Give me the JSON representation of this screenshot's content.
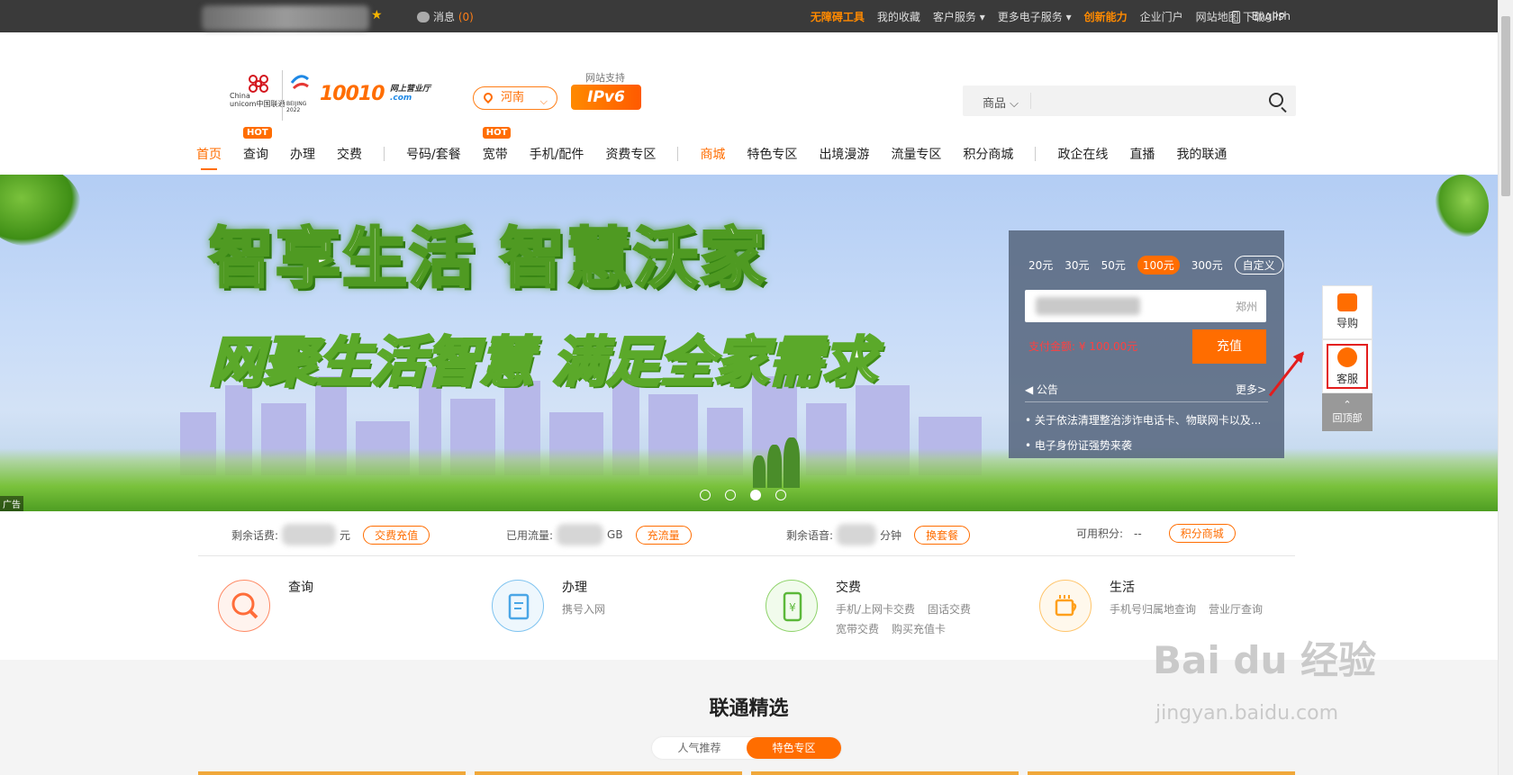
{
  "topbar": {
    "star": "★",
    "message_label": "消息",
    "message_count": "(0)",
    "links": [
      "无障碍工具",
      "我的收藏",
      "客户服务 ▾",
      "更多电子服务 ▾",
      "创新能力",
      "企业门户",
      "网站地图",
      "English"
    ],
    "app_label": "下载APP"
  },
  "header": {
    "logo_brand_line1": "China",
    "logo_brand_line2": "unicom中国联通",
    "logo_olympic": "BEIJING 2022",
    "logo_number": "10010",
    "logo_sub1": "网上营业厅",
    "logo_sub2": ".com",
    "province": "河南",
    "ipv6_caption": "网站支持",
    "ipv6_label": "IPv6",
    "search_category": "商品 ⌵",
    "search_value": ""
  },
  "nav": {
    "items": [
      "首页",
      "查询",
      "办理",
      "交费",
      "号码/套餐",
      "宽带",
      "手机/配件",
      "资费专区",
      "商城",
      "特色专区",
      "出境漫游",
      "流量专区",
      "积分商城",
      "政企在线",
      "直播",
      "我的联通"
    ],
    "hot_badge": "HOT"
  },
  "banner": {
    "headline1": "智享生活 智慧沃家",
    "headline2": "网聚生活智慧 满足全家需求",
    "ad_tag": "广告"
  },
  "recharge": {
    "amounts": [
      "20元",
      "30元",
      "50元",
      "100元",
      "300元"
    ],
    "selected_amount": "100元",
    "custom_label": "自定义",
    "city": "郑州",
    "pay_text": "支付金额: ¥ 100.00元",
    "button": "充值",
    "announce_title": "公告",
    "announce_more": "更多>",
    "notices": [
      "• 关于依法清理整治涉诈电话卡、物联网卡以及...",
      "• 电子身份证强势来袭"
    ]
  },
  "float_bar": {
    "guide": "导购",
    "service": "客服",
    "top": "回顶部"
  },
  "stats": {
    "balance_label": "剩余话费:",
    "balance_unit": "元",
    "balance_btn": "交费充值",
    "flow_label": "已用流量:",
    "flow_unit": "GB",
    "flow_btn": "充流量",
    "voice_label": "剩余语音:",
    "voice_unit": "分钟",
    "voice_btn": "换套餐",
    "points_label": "可用积分:",
    "points_value": "--",
    "points_btn": "积分商城"
  },
  "services": [
    {
      "title": "查询",
      "subs": []
    },
    {
      "title": "办理",
      "subs": [
        "携号入网"
      ]
    },
    {
      "title": "交费",
      "subs": [
        "手机/上网卡交费",
        "固话交费",
        "宽带交费",
        "购买充值卡"
      ]
    },
    {
      "title": "生活",
      "subs": [
        "手机号归属地查询",
        "营业厅查询"
      ]
    }
  ],
  "section": {
    "title": "联通精选",
    "tabs": [
      "人气推荐",
      "特色专区"
    ]
  },
  "watermark": {
    "line1": "Bai du 经验",
    "line2": "jingyan.baidu.com"
  },
  "colors": {
    "accent": "#ff6d00",
    "topbar": "#3a3a3a",
    "highlight_red": "#e31d1d"
  }
}
